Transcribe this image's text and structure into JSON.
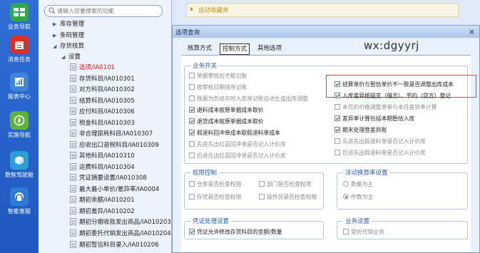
{
  "nav": {
    "items": [
      {
        "label": "业务导航",
        "icon": "app-grid-icon",
        "color": "#2fa84a"
      },
      {
        "label": "消息任务",
        "icon": "calendar-icon",
        "color": "#d9312a"
      },
      {
        "label": "报表中心",
        "icon": "report-chart-icon",
        "color": "#3d86d8"
      },
      {
        "label": "实施导航",
        "icon": "compass-icon",
        "color": "#5fb33a"
      },
      {
        "label": "数智驾驶舱",
        "icon": "cube-icon",
        "color": "#2c9fd6"
      },
      {
        "label": "智能客服",
        "icon": "headset-icon",
        "color": "#2e7bd4"
      }
    ]
  },
  "tree": {
    "search_placeholder": "请输入您要搜索的功能",
    "items": [
      {
        "label": "库存管理",
        "type": "folder"
      },
      {
        "label": "条码管理",
        "type": "folder"
      },
      {
        "label": "存货核算",
        "type": "folder-open"
      },
      {
        "label": "设置",
        "type": "folder-open"
      },
      {
        "label": "选项/IA0101",
        "type": "doc",
        "selected": true
      },
      {
        "label": "存货科目/IA010301",
        "type": "doc"
      },
      {
        "label": "对方科目/IA010302",
        "type": "doc"
      },
      {
        "label": "结算科目/IA010305",
        "type": "doc"
      },
      {
        "label": "应付科目/IA010306",
        "type": "doc"
      },
      {
        "label": "税金科目/IA010303",
        "type": "doc"
      },
      {
        "label": "非合理损耗科目/IA010307",
        "type": "doc"
      },
      {
        "label": "应收出口退税科目/IA010309",
        "type": "doc"
      },
      {
        "label": "其他科目/IA010310",
        "type": "doc"
      },
      {
        "label": "运费科目/IA010304",
        "type": "doc"
      },
      {
        "label": "凭证摘要设置/IA010308",
        "type": "doc"
      },
      {
        "label": "最大最小单价/差异率/IA0004",
        "type": "doc"
      },
      {
        "label": "期初余额/IA010201",
        "type": "doc"
      },
      {
        "label": "期初差异/IA010202",
        "type": "doc"
      },
      {
        "label": "期初分期收款发出商品/IA010203",
        "type": "doc"
      },
      {
        "label": "期初委托代销发出商品/IA010204",
        "type": "doc"
      },
      {
        "label": "期初暂估科目录入/IA010206",
        "type": "doc"
      }
    ]
  },
  "favorites": {
    "label": "自动收藏夹"
  },
  "dialog": {
    "title": "选项查询",
    "close": "×",
    "watermark": "wx:dgyyrj",
    "tabs": [
      "核算方式",
      "控制方式",
      "其他选项"
    ],
    "groups": {
      "business_switch": {
        "title": "业务开关",
        "left": [
          {
            "label": "单据审核后才能记账",
            "checked": false
          },
          {
            "label": "按审核日期排序记账",
            "checked": false
          },
          {
            "label": "账面为负结存时入库单记账自动生成出库调整",
            "checked": false
          },
          {
            "label": "退料成本按原单据成本取价",
            "checked": true
          },
          {
            "label": "退货成本按原单据成本取价",
            "checked": true
          },
          {
            "label": "假退料回冲单成本取假退料单成本",
            "checked": true
          },
          {
            "label": "先进先出红蓝回冲单是否记入计价库",
            "checked": false
          },
          {
            "label": "后进先出红蓝回冲单是否记入计价库",
            "checked": false
          }
        ],
        "right": [
          {
            "label": "结算单价与暂估单价不一致是否调整出库成本",
            "checked": true
          },
          {
            "label": "入库差异按超支（借方）、节约（贷方）登记",
            "checked": true
          },
          {
            "label": "本月的价格调整单参与本月差异率计算",
            "checked": false
          },
          {
            "label": "差异率计算包括本期暂估入库",
            "checked": true
          },
          {
            "label": "期末处理登差异账",
            "checked": true
          },
          {
            "label": "先进先出假退料单是否记入计价库",
            "checked": false
          },
          {
            "label": "后进先出假退料单是否记入计价库",
            "checked": false
          }
        ]
      },
      "permission": {
        "title": "权限控制",
        "items": [
          {
            "label": "仓库是否检查权限",
            "checked": false
          },
          {
            "label": "部门是否检查权限",
            "checked": false
          },
          {
            "label": "存货是否检查权限",
            "checked": false
          },
          {
            "label": "操作员是否检查权限",
            "checked": false
          }
        ]
      },
      "float_exchange": {
        "title": "浮动换算率设置",
        "options": [
          {
            "label": "数量为主",
            "selected": false
          },
          {
            "label": "件数为主",
            "selected": true
          }
        ]
      },
      "voucher": {
        "title": "凭证处理设置",
        "items": [
          {
            "label": "凭证允许修改存货科目的金额/数量",
            "checked": true
          }
        ]
      },
      "business": {
        "title": "业务设置",
        "items": [
          {
            "label": "受托代销业务",
            "checked": false
          }
        ]
      }
    }
  }
}
